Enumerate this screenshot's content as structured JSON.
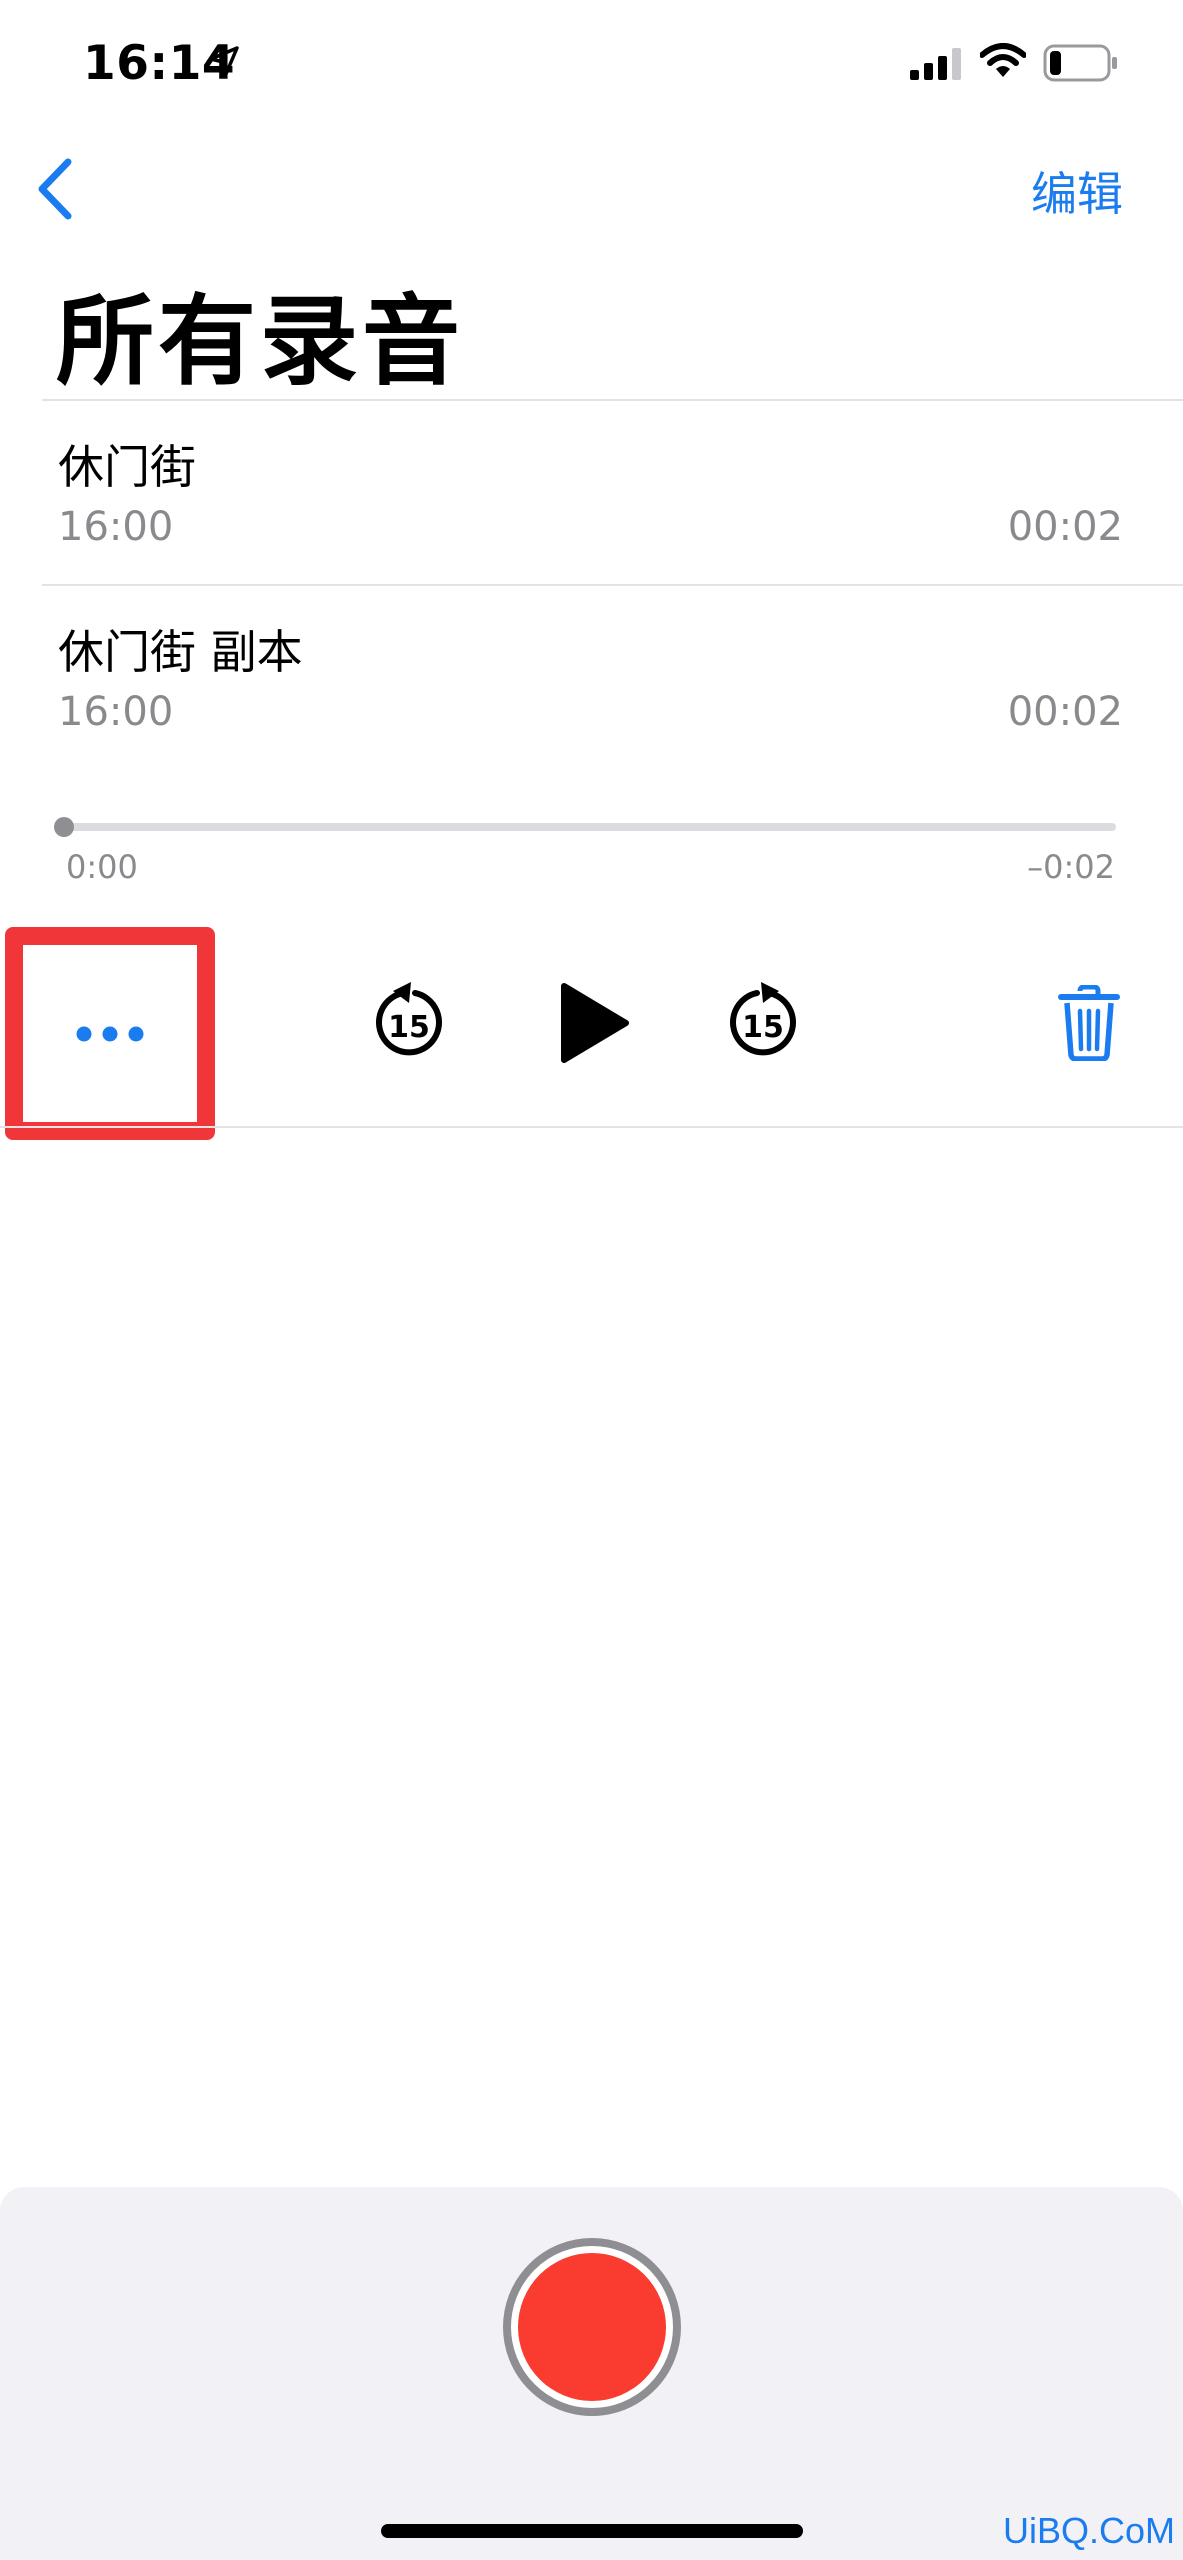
{
  "status_bar": {
    "time": "16:14",
    "icons": [
      "location-arrow-icon",
      "cellular-signal-icon",
      "wifi-icon",
      "battery-icon"
    ]
  },
  "nav": {
    "back_icon": "chevron-left-icon",
    "edit_label": "编辑",
    "title": "所有录音"
  },
  "recordings": [
    {
      "name": "休门街",
      "time": "16:00",
      "duration": "00:02"
    },
    {
      "name": "休门街 副本",
      "time": "16:00",
      "duration": "00:02"
    }
  ],
  "player": {
    "elapsed": "0:00",
    "remaining": "–0:02",
    "progress": 0.0,
    "controls": [
      "more-icon",
      "skip-back-15-icon",
      "play-icon",
      "skip-forward-15-icon",
      "trash-icon"
    ],
    "skip_seconds": "15"
  },
  "record": {
    "icon": "record-icon"
  },
  "watermark": "UiBQ.CoM",
  "colors": {
    "accent": "#1a7cef",
    "highlight_box": "#f1363a",
    "record_red": "#fa3b2f",
    "secondary_text": "#8a8a8e",
    "panel_bg": "#f2f2f6"
  }
}
